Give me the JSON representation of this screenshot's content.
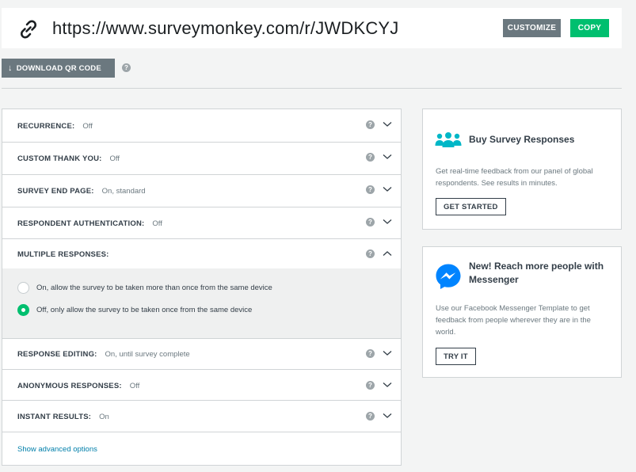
{
  "url_bar": {
    "link_icon": "link-icon",
    "url": "https://www.surveymonkey.com/r/JWDKCYJ",
    "customize_label": "CUSTOMIZE",
    "copy_label": "COPY"
  },
  "qr": {
    "download_label": "DOWNLOAD QR CODE",
    "help_glyph": "?"
  },
  "settings": {
    "help_glyph": "?",
    "rows": [
      {
        "label": "RECURRENCE:",
        "value": "Off"
      },
      {
        "label": "CUSTOM THANK YOU:",
        "value": "Off"
      },
      {
        "label": "SURVEY END PAGE:",
        "value": "On, standard"
      },
      {
        "label": "RESPONDENT AUTHENTICATION:",
        "value": "Off"
      },
      {
        "label": "MULTIPLE RESPONSES:",
        "value": ""
      },
      {
        "label": "RESPONSE EDITING:",
        "value": "On, until survey complete"
      },
      {
        "label": "ANONYMOUS RESPONSES:",
        "value": "Off"
      },
      {
        "label": "INSTANT RESULTS:",
        "value": "On"
      }
    ],
    "multiple_responses_options": [
      {
        "label": "On, allow the survey to be taken more than once from the same device",
        "selected": false
      },
      {
        "label": "Off, only allow the survey to be taken once from the same device",
        "selected": true
      }
    ],
    "advanced_link": "Show advanced options"
  },
  "cards": {
    "buy": {
      "icon": "people-icon",
      "title": "Buy Survey Responses",
      "description": "Get real-time feedback from our panel of global respondents. See results in minutes.",
      "button": "GET STARTED"
    },
    "messenger": {
      "icon": "messenger-icon",
      "title": "New! Reach more people with Messenger",
      "description": "Use our Facebook Messenger Template to get feedback from people wherever they are in the world.",
      "button": "TRY IT"
    }
  },
  "colors": {
    "accent_green": "#00bf6f",
    "button_gray": "#6b787f",
    "link_blue": "#007faa",
    "people_teal": "#00b7c7",
    "messenger_blue": "#0084ff"
  }
}
